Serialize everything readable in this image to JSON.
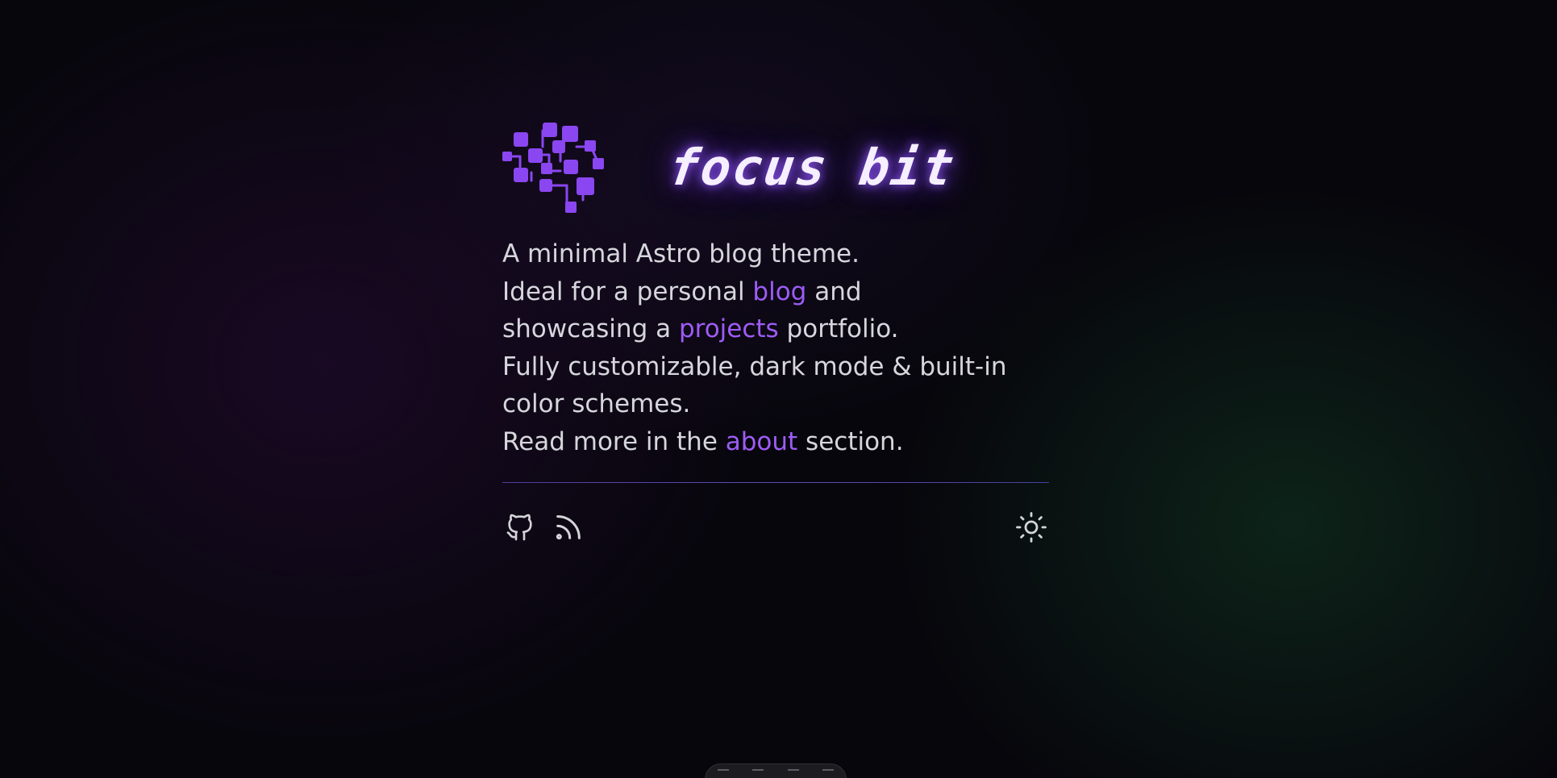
{
  "header": {
    "brand": "focus bit",
    "logo_icon": "circuit-brain-icon",
    "accent_color": "#9d5cf6"
  },
  "intro": {
    "line1": "A minimal Astro blog theme.",
    "line2_pre": "Ideal for a personal ",
    "line2_link": "blog",
    "line2_post": " and",
    "line3_pre": "showcasing a ",
    "line3_link": "projects",
    "line3_post": " portfolio.",
    "line4": "Fully customizable, dark mode & built-in",
    "line5": "color schemes.",
    "line6_pre": "Read more in the ",
    "line6_link": "about",
    "line6_post": " section."
  },
  "footer": {
    "social_icons": [
      "github-icon",
      "rss-icon"
    ],
    "theme_toggle_icon": "sun-icon"
  }
}
